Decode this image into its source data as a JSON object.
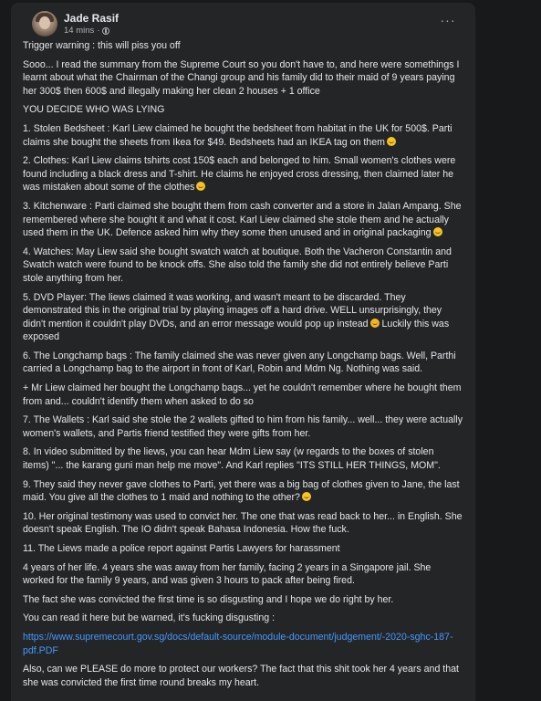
{
  "post": {
    "author": "Jade Rasif",
    "time": "14 mins",
    "separator": "·",
    "more_label": "···"
  },
  "content": {
    "p0": "Trigger warning : this will piss you off",
    "p1": "Sooo... I read the summary from the Supreme Court so you don't have to, and here were somethings I learnt about what the Chairman of the Changi group and his family did to their maid of 9 years paying her 300$ then 600$ and illegally making her clean 2 houses + 1 office",
    "p2": "YOU DECIDE WHO WAS LYING",
    "p3": "1. Stolen Bedsheet : Karl Liew claimed he bought the bedsheet from habitat in the UK for 500$. Parti claims she bought the sheets from Ikea for $49. Bedsheets had an IKEA tag on them",
    "p4": "2. Clothes: Karl Liew claims tshirts cost 150$ each and belonged to him. Small women's clothes were found including a black dress and T-shirt. He claims he enjoyed cross dressing, then claimed later he was mistaken about some of the clothes",
    "p5": "3. Kitchenware : Parti claimed she bought them from cash converter and a store in Jalan Ampang. She remembered where she bought it and what it cost. Karl Liew claimed she stole them and he actually used them in the UK. Defence asked him why they some then unused and in original packaging",
    "p6": "4. Watches: May Liew said she bought swatch watch at boutique. Both the Vacheron Constantin and Swatch watch were found to be knock offs. She also told the family she did not entirely believe Parti stole anything from her.",
    "p7": "5. DVD Player: The liews claimed it was working, and wasn't meant to be discarded. They demonstrated this in the original trial by playing images off a hard drive. WELL unsurprisingly, they didn't mention it couldn't play DVDs, and an error message would pop up instead",
    "p7b": "Luckily this was exposed",
    "p8": "6. The Longchamp bags : The family claimed she was never given any Longchamp bags. Well, Parthi carried a Longchamp bag to the airport in front of Karl, Robin and Mdm Ng. Nothing was said.",
    "p9": "+ Mr Liew claimed her bought the Longchamp bags... yet he couldn't remember where he bought them from and... couldn't identify them when asked to do so",
    "p10": "7. The Wallets : Karl said she stole the 2 wallets gifted to him from his family... well... they were actually women's wallets, and Partis friend testified they were gifts from her.",
    "p11": "8. In video submitted by the liews, you can hear Mdm Liew say (w regards to the boxes of stolen items) \"... the karang guni man help me move\". And Karl replies \"ITS STILL HER THINGS, MOM\".",
    "p12": "9. They said they never gave clothes to Parti, yet there was a big bag of clothes given to Jane, the last maid. You give all the clothes to 1 maid and nothing to the other?",
    "p13": "10. Her original testimony was used to convict her. The one that was read back to her... in English. She doesn't speak English. The IO didn't speak Bahasa Indonesia. How the fuck.",
    "p14": "11. The Liews made a police report against Partis Lawyers for harassment",
    "p15": "4 years of her life. 4 years she was away from her family, facing 2 years in a Singapore jail. She worked for the family 9 years, and was given 3 hours to pack after being fired.",
    "p16": "The fact she was convicted the first time is so disgusting and I hope we do right by her.",
    "p17": "You can read it here but be warned, it's fucking disgusting :",
    "link": "https://www.supremecourt.gov.sg/docs/default-source/module-document/judgement/-2020-sghc-187-pdf.PDF",
    "p18": "Also, can we PLEASE do more to protect our workers? The fact that this shit took her 4 years and that she was convicted the first time round breaks my heart."
  },
  "icons": {
    "avatar": "profile-photo",
    "privacy": "globe-icon",
    "more": "more-options-icon",
    "emoji": "smiling-face-emoji",
    "laugh_emoji": "laughing-face-emoji"
  },
  "colors": {
    "page_bg": "#18191a",
    "card_bg": "#242526",
    "text": "#e4e6eb",
    "secondary_text": "#b0b3b8",
    "link": "#4599ff"
  }
}
